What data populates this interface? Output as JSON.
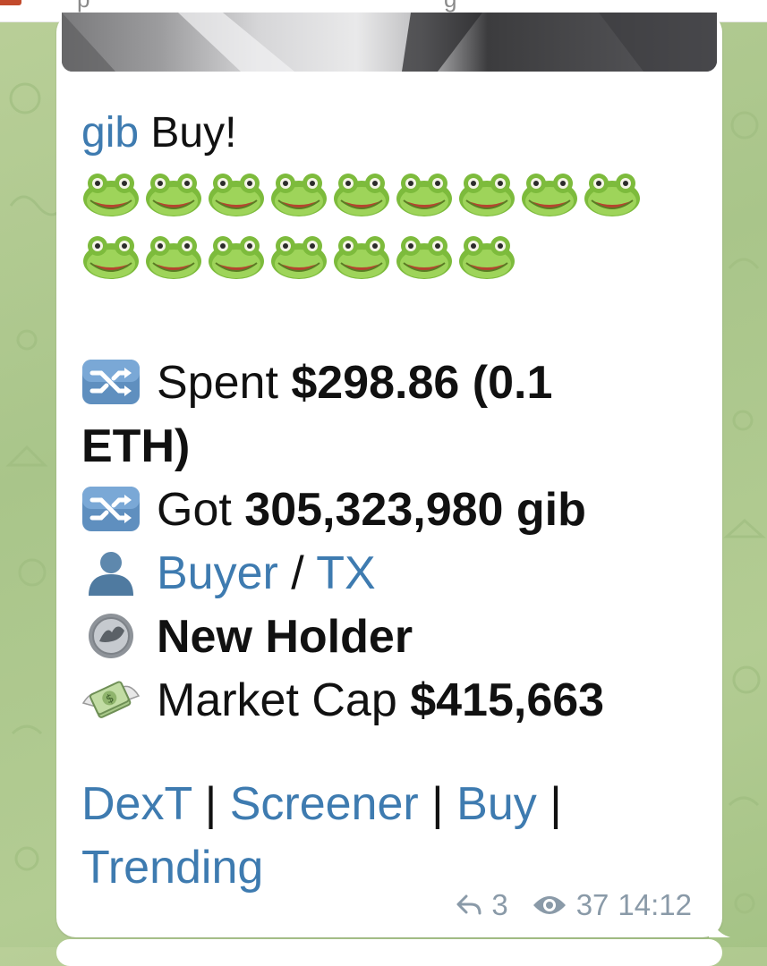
{
  "message": {
    "token_link": "gib",
    "title_rest": "Buy!",
    "frog_rows": [
      [
        "frog-icon",
        "frog-icon",
        "frog-icon",
        "frog-icon",
        "frog-icon",
        "frog-icon",
        "frog-icon",
        "frog-icon",
        "frog-icon"
      ],
      [
        "frog-icon",
        "frog-icon",
        "frog-icon",
        "frog-icon",
        "frog-icon",
        "frog-icon",
        "frog-icon"
      ]
    ],
    "spent_label": "Spent",
    "spent_value_line1": "$298.86 (0.1",
    "spent_value_line2": "ETH)",
    "got_label": "Got",
    "got_value": "305,323,980 gib",
    "buyer_link": "Buyer",
    "separator": "/",
    "tx_link": "TX",
    "holder_text": "New Holder",
    "mcap_label": "Market Cap",
    "mcap_value": "$415,663",
    "links": {
      "dext": "DexT",
      "sep1": "|",
      "screener": "Screener",
      "sep2": "|",
      "buy": "Buy",
      "sep3": "|",
      "trending": "Trending"
    }
  },
  "meta": {
    "forwards": "3",
    "views": "37",
    "time": "14:12"
  },
  "colors": {
    "link": "#3e7bb0",
    "text": "#111111",
    "meta": "#8a9aa8",
    "bubble": "#ffffff",
    "background": "#b3cc93"
  },
  "icons": {
    "shuffle": "shuffle-icon",
    "buyer": "bust-in-silhouette-icon",
    "holder": "coin-icon",
    "mcap": "money-with-wings-icon",
    "forward": "forward-icon",
    "views": "eye-icon"
  }
}
